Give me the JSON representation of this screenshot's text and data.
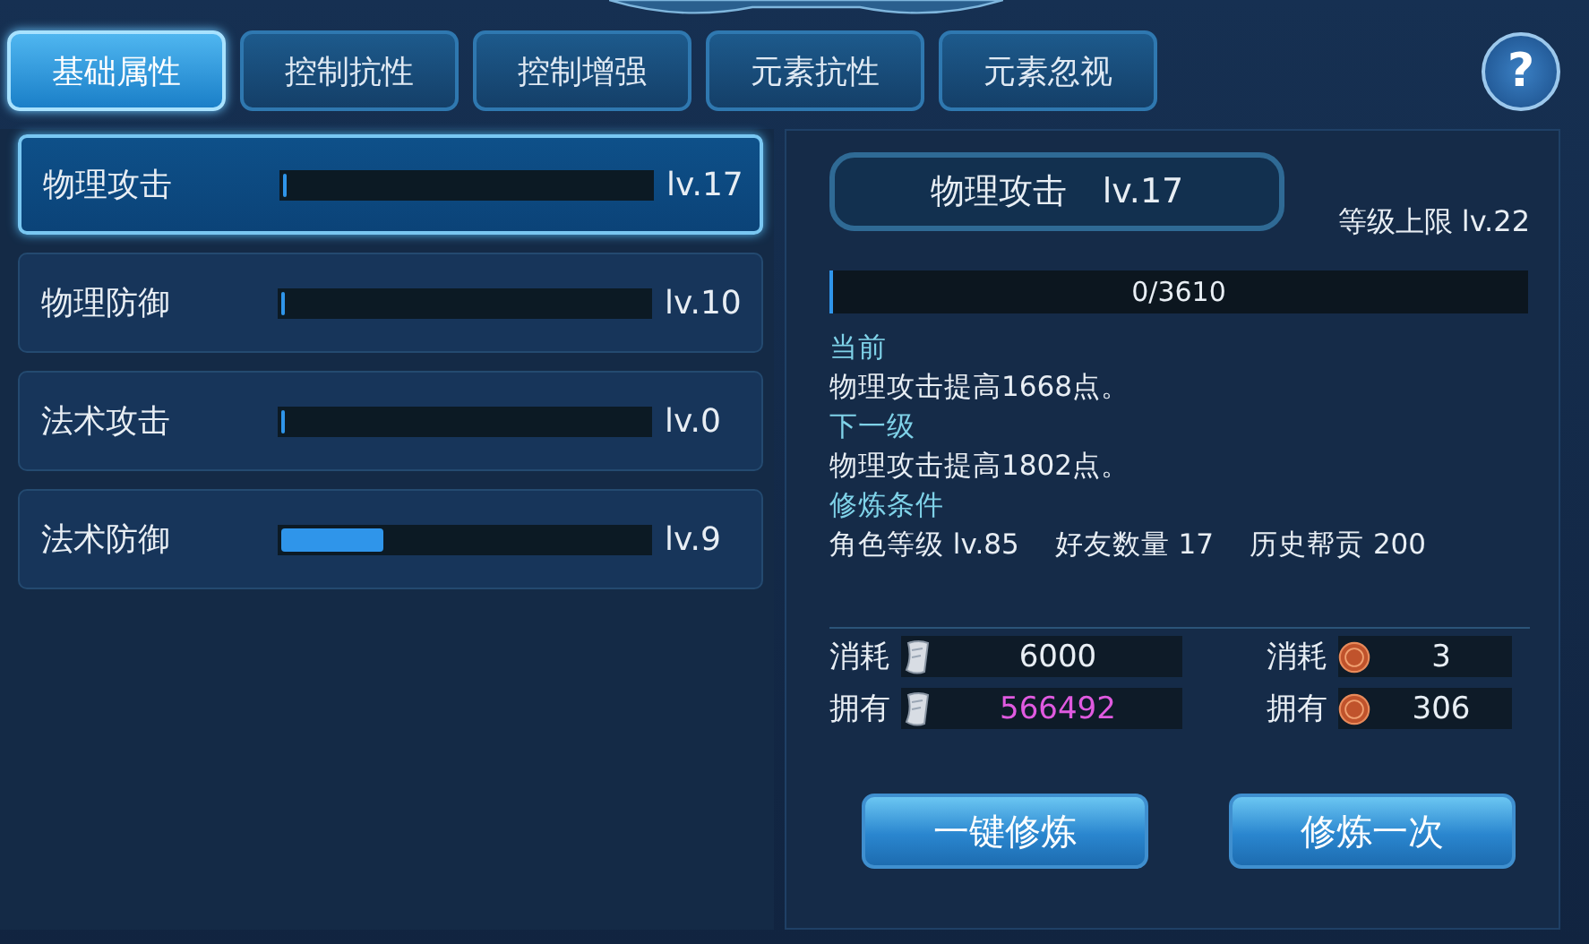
{
  "tabs": [
    {
      "label": "基础属性",
      "selected": true
    },
    {
      "label": "控制抗性",
      "selected": false
    },
    {
      "label": "控制增强",
      "selected": false
    },
    {
      "label": "元素抗性",
      "selected": false
    },
    {
      "label": "元素忽视",
      "selected": false
    }
  ],
  "help_button": {
    "label": "?"
  },
  "skills": [
    {
      "name": "物理攻击",
      "level": 0,
      "reading": "lv.17",
      "selected": true
    },
    {
      "name": "物理防御",
      "level": 0,
      "reading": "lv.10",
      "selected": false
    },
    {
      "name": "法术攻击",
      "level": 0,
      "reading": "lv.0",
      "selected": false
    },
    {
      "name": "法术防御",
      "level": 0.28,
      "reading": "lv.9",
      "selected": false
    }
  ],
  "detail": {
    "title": "物理攻击",
    "title_level": "lv.17",
    "level_cap": "等级上限 lv.22",
    "progress": {
      "level": 0,
      "reading": "0/3610"
    },
    "sections": [
      {
        "heading": "当前",
        "text": "物理攻击提高1668点。"
      },
      {
        "heading": "下一级",
        "text": "物理攻击提高1802点。"
      },
      {
        "heading": "修炼条件",
        "conditions": [
          "角色等级 lv.85",
          "好友数量 17",
          "历史帮贡 200"
        ]
      }
    ],
    "costs": [
      {
        "label": "消耗",
        "kind": "scroll",
        "value": "6000",
        "highlight": false
      },
      {
        "label": "消耗",
        "kind": "coin",
        "value": "3",
        "highlight": false
      },
      {
        "label": "拥有",
        "kind": "scroll",
        "value": "566492",
        "highlight": true
      },
      {
        "label": "拥有",
        "kind": "coin",
        "value": "306",
        "highlight": false
      }
    ],
    "buttons": [
      "一键修炼",
      "修炼一次"
    ]
  }
}
